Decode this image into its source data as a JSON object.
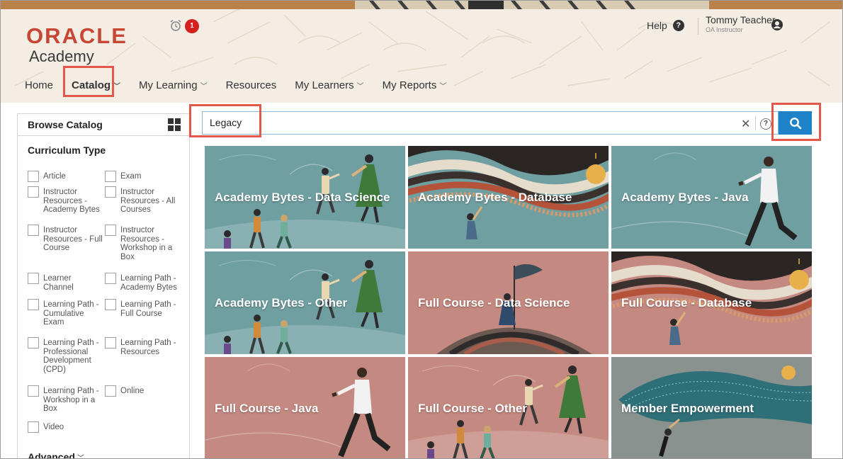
{
  "header": {
    "logo": {
      "brand": "ORACLE",
      "product": "Academy"
    },
    "alarm": {
      "icon": "alarm-clock-icon",
      "badge": "1"
    },
    "help": {
      "label": "Help",
      "icon": "question-circle-icon"
    },
    "user": {
      "name": "Tommy Teacher",
      "role": "OA Instructor",
      "icon": "user-avatar-icon"
    }
  },
  "nav": {
    "items": [
      {
        "label": "Home",
        "dropdown": false
      },
      {
        "label": "Catalog",
        "dropdown": true
      },
      {
        "label": "My Learning",
        "dropdown": true
      },
      {
        "label": "Resources",
        "dropdown": false
      },
      {
        "label": "My Learners",
        "dropdown": true
      },
      {
        "label": "My Reports",
        "dropdown": true
      }
    ]
  },
  "sidebar": {
    "title": "Browse Catalog",
    "view_icon": "grid-view-icon",
    "section": "Curriculum Type",
    "filters": [
      "Article",
      "Exam",
      "Instructor Resources - Academy Bytes",
      "Instructor Resources - All Courses",
      "Instructor Resources - Full Course",
      "Instructor Resources - Workshop in a Box",
      "Learner Channel",
      "Learning Path - Academy Bytes",
      "Learning Path - Cumulative Exam",
      "Learning Path - Full Course",
      "Learning Path - Professional Development (CPD)",
      "Learning Path - Resources",
      "Learning Path - Workshop in a Box",
      "Online",
      "Video"
    ],
    "advanced": "Advanced"
  },
  "search": {
    "value": "Legacy",
    "clear_icon": "close-icon",
    "help": "?",
    "button_icon": "search-icon"
  },
  "tiles": [
    {
      "title": "Academy Bytes - Data Science",
      "bg": "#6f9fa1",
      "art": "people"
    },
    {
      "title": "Academy Bytes - Database",
      "bg": "#6f9fa1",
      "art": "waves"
    },
    {
      "title": "Academy Bytes - Java",
      "bg": "#6f9fa1",
      "art": "runner"
    },
    {
      "title": "Academy Bytes - Other",
      "bg": "#6f9fa1",
      "art": "people"
    },
    {
      "title": "Full Course - Data Science",
      "bg": "#c48980",
      "art": "flag"
    },
    {
      "title": "Full Course - Database",
      "bg": "#c48980",
      "art": "waves"
    },
    {
      "title": "Full Course - Java",
      "bg": "#c48980",
      "art": "runner"
    },
    {
      "title": "Full Course - Other",
      "bg": "#c48980",
      "art": "people"
    },
    {
      "title": "Member Empowerment",
      "bg": "#8a9290",
      "art": "swim"
    }
  ],
  "colors": {
    "oracle_red": "#c74634",
    "search_blue": "#1d82c8",
    "highlight": "#e4584c"
  }
}
